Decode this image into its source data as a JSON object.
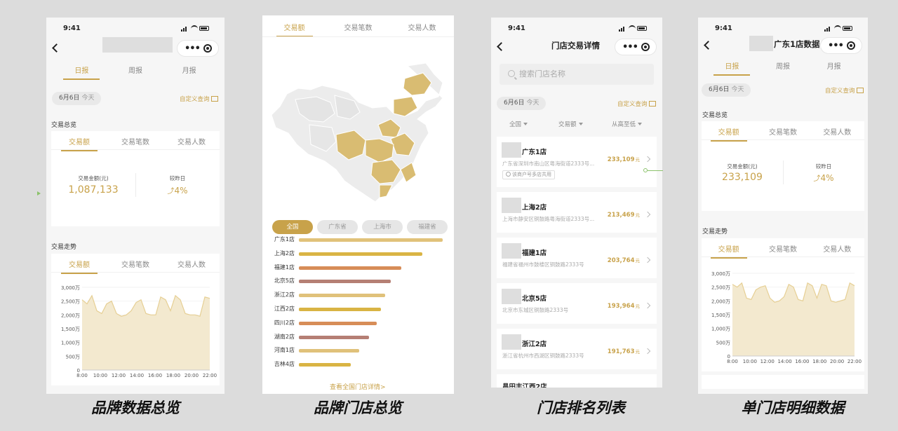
{
  "status": {
    "time": "9:41"
  },
  "common": {
    "period_tabs": [
      "日报",
      "周报",
      "月报"
    ],
    "metric_tabs": [
      "交易额",
      "交易笔数",
      "交易人数"
    ],
    "date_main": "6月6日",
    "date_sub": "今天",
    "custom_query": "自定义查询",
    "overview_title": "交易总览",
    "trend_title": "交易走势",
    "kpi_label": "交易金额(元)",
    "kpi_compare_label": "较昨日",
    "trend_icon": "trend-up-icon"
  },
  "screen1": {
    "caption": "品牌数据总览",
    "kpi_value": "1,087,133",
    "kpi_change": "4%",
    "chart_data": {
      "type": "area",
      "x": [
        "8:00",
        "10:00",
        "12:00",
        "14:00",
        "16:00",
        "18:00",
        "20:00",
        "22:00"
      ],
      "x_labels": [
        "8:00",
        "10:00",
        "12:00",
        "14:00",
        "16:00",
        "18:00",
        "20:00",
        "22:00"
      ],
      "y_ticks": [
        "0",
        "500万",
        "1,000万",
        "1,500万",
        "2,000万",
        "2,500万",
        "3,000万"
      ],
      "ylim": [
        0,
        3000
      ],
      "values": [
        2550,
        2400,
        2700,
        2150,
        2050,
        2400,
        2500,
        2050,
        1950,
        2000,
        2150,
        2450,
        2550,
        2050,
        2000,
        2000,
        2650,
        2550,
        2150,
        2700,
        2550,
        2050,
        2000,
        2000,
        1950,
        2650,
        2600
      ],
      "color": "#e6cf94"
    }
  },
  "screen2": {
    "caption": "品牌门店总览",
    "tabs": [
      "交易额",
      "交易笔数",
      "交易人数"
    ],
    "regions": [
      "全国",
      "广东省",
      "上海市",
      "福建省"
    ],
    "chart_data": {
      "type": "bar",
      "orientation": "horizontal",
      "categories": [
        "广东1店",
        "上海2店",
        "福建1店",
        "北京5店",
        "浙江2店",
        "江西2店",
        "四川2店",
        "湖南2店",
        "河南1店",
        "吉林4店"
      ],
      "values": [
        100,
        86,
        71,
        64,
        60,
        57,
        54,
        49,
        42,
        36
      ],
      "colors": [
        "#e1c27a",
        "#d9b444",
        "#d78d58",
        "#b57f74",
        "#e0c17a",
        "#d9b444",
        "#d78d58",
        "#b57f74",
        "#e0c17a",
        "#d9b444"
      ]
    },
    "link_all": "查看全国门店详情>"
  },
  "screen3": {
    "caption": "门店排名列表",
    "title": "门店交易详情",
    "search_placeholder": "搜索门店名称",
    "filters": [
      "全国",
      "交易额",
      "从高至低"
    ],
    "stores": [
      {
        "name": "广东1店",
        "address": "广东省深圳市南山区粤海街道2333号...",
        "amount": "233,109",
        "unit": "元",
        "badge": "该商户号多店共用"
      },
      {
        "name": "上海2店",
        "address": "上海市静安区铜鼓路粤海街道2333号...",
        "amount": "213,469",
        "unit": "元"
      },
      {
        "name": "福建1店",
        "address": "福建省福州市鼓楼区铜鼓路2333号",
        "amount": "203,764",
        "unit": "元"
      },
      {
        "name": "北京5店",
        "address": "北京市东城区铜鼓路2333号",
        "amount": "193,964",
        "unit": "元"
      },
      {
        "name": "浙江2店",
        "address": "浙江省杭州市西湖区铜鼓路2333号",
        "amount": "191,763",
        "unit": "元"
      }
    ],
    "partial_row": "昌田丰江西2店"
  },
  "screen4": {
    "caption": "单门店明细数据",
    "title": "广东1店数据",
    "kpi_value": "233,109",
    "kpi_change": "4%",
    "chart_data": {
      "type": "area",
      "x": [
        "8:00",
        "10:00",
        "12:00",
        "14:00",
        "16:00",
        "18:00",
        "20:00",
        "22:00"
      ],
      "x_labels": [
        "8:00",
        "10:00",
        "12:00",
        "14:00",
        "16:00",
        "18:00",
        "20:00",
        "22:00"
      ],
      "y_ticks": [
        "0",
        "500万",
        "1,000万",
        "1,500万",
        "2,000万",
        "2,500万",
        "3,000万"
      ],
      "ylim": [
        0,
        3000
      ],
      "values": [
        2600,
        2500,
        2650,
        2100,
        2050,
        2400,
        2500,
        2550,
        2100,
        1950,
        2000,
        2150,
        2600,
        2500,
        2050,
        2000,
        2650,
        2550,
        2100,
        2600,
        2550,
        2000,
        1950,
        2000,
        2050,
        2650,
        2550
      ],
      "color": "#e6cf94"
    }
  }
}
